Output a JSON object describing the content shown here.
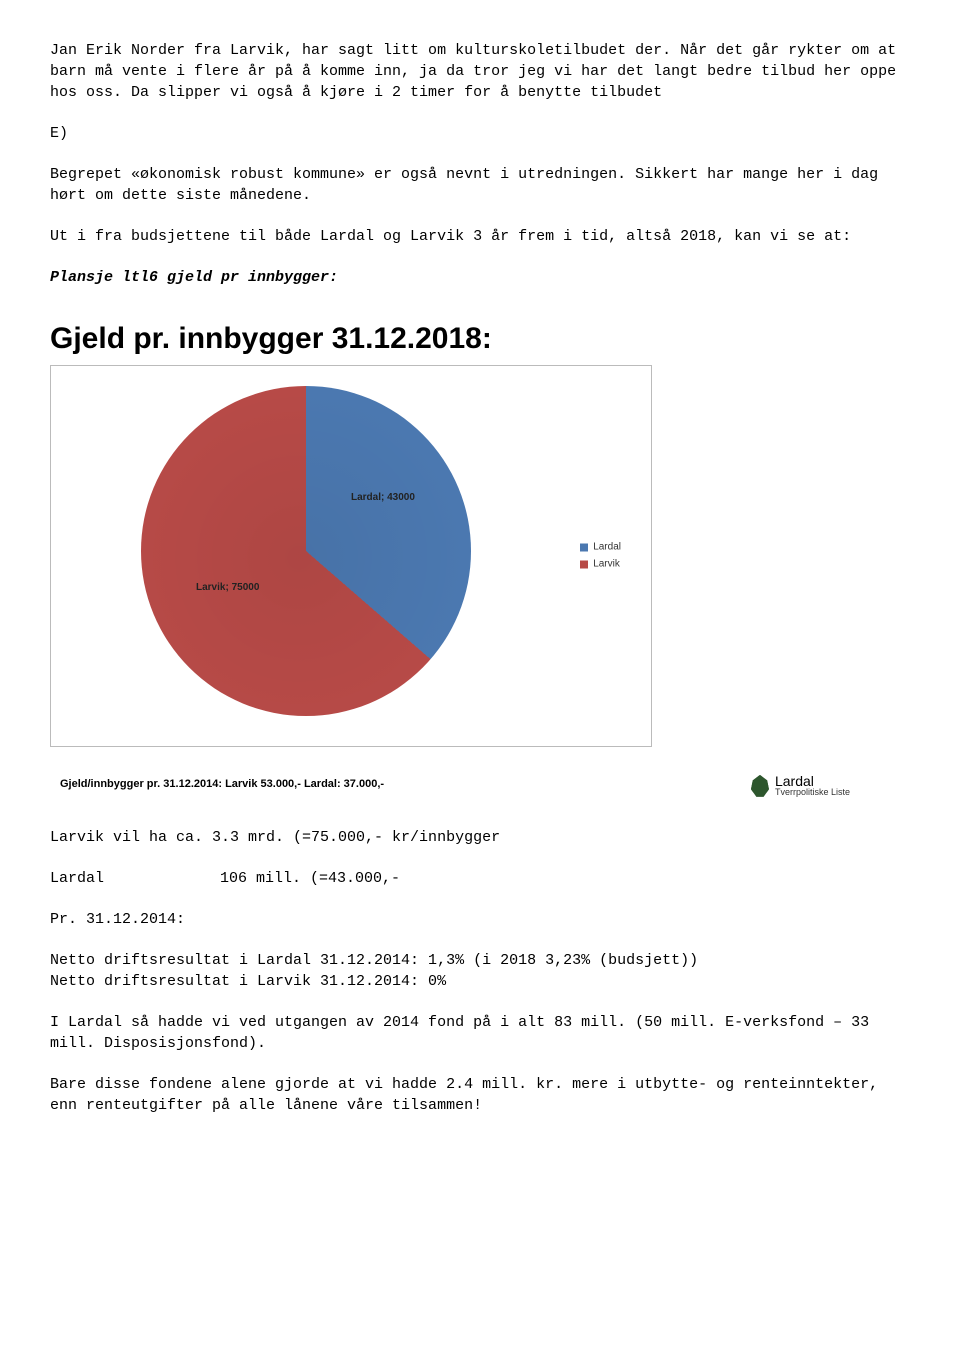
{
  "paragraphs": {
    "p1": "Jan Erik Norder fra Larvik, har sagt litt om kulturskoletilbudet der. Når det går rykter om at barn må vente i flere år på å komme inn, ja da tror jeg vi har det langt bedre tilbud her oppe hos oss. Da slipper vi også å kjøre i 2 timer for å benytte tilbudet",
    "sectionE": "E)",
    "p2": "Begrepet «økonomisk robust kommune» er også nevnt i utredningen. Sikkert har mange her i dag hørt om dette siste månedene.",
    "p3": "Ut i fra budsjettene til både Lardal og Larvik 3 år frem i tid, altså 2018, kan vi se at:",
    "planLine": "Plansje ltl6 gjeld pr innbygger:",
    "afterChart1": "Larvik vil ha ca. 3.3 mrd.  (=75.000,- kr/innbygger",
    "row2c1": "Lardal",
    "row2c2": "106 mill.  (=43.000,-",
    "prLine": "Pr. 31.12.2014:",
    "netto": "Netto driftsresultat i Lardal 31.12.2014: 1,3%     (i 2018 3,23% (budsjett))\nNetto driftsresultat i Larvik 31.12.2014:   0%",
    "p4": "I Lardal så hadde vi ved utgangen av 2014 fond på i alt 83 mill. (50 mill. E-verksfond – 33 mill. Disposisjonsfond).",
    "p5": "Bare disse fondene alene gjorde at vi hadde 2.4 mill. kr. mere i utbytte- og renteinntekter, enn renteutgifter på alle lånene våre tilsammen!"
  },
  "chart_data": {
    "type": "pie",
    "title": "Gjeld pr. innbygger 31.12.2018:",
    "series": [
      {
        "name": "Lardal",
        "value": 43000,
        "label": "Lardal; 43000",
        "color": "#4b78b0"
      },
      {
        "name": "Larvik",
        "value": 75000,
        "label": "Larvik; 75000",
        "color": "#b74a47"
      }
    ],
    "legend": [
      "Lardal",
      "Larvik"
    ],
    "footnote": "Gjeld/innbygger pr. 31.12.2014:  Larvik 53.000,-  Lardal: 37.000,-"
  },
  "branding": {
    "line1": "Lardal",
    "line2": "Tverrpolitiske Liste"
  }
}
